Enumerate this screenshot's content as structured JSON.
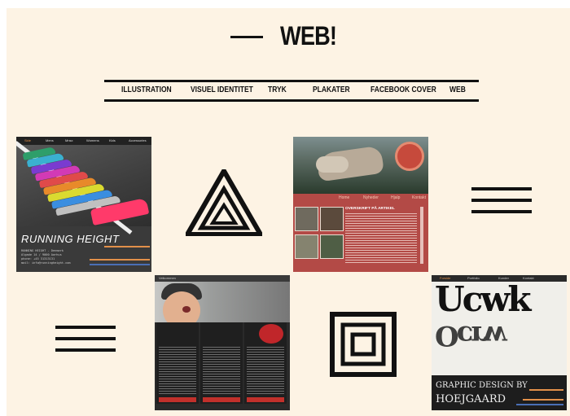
{
  "header": {
    "title": "WEB!"
  },
  "nav": [
    "ILLUSTRATION",
    "VISUEL IDENTITET",
    "TRYK",
    "PLAKATER",
    "FACEBOOK COVER",
    "WEB"
  ],
  "thumb1": {
    "menu": [
      "Side",
      "Mens",
      "Mnsx",
      "Womens",
      "Kids",
      "Accessories"
    ],
    "brand": "RUNNING HEIGHT",
    "meta": [
      "RUNNING HEIGHT - Denmark",
      "Algade 14 / 9000 Aarhus",
      "phone: +45 31313131",
      "mail: info@runningheight.com"
    ],
    "shoe_colors": [
      "#2e9e6a",
      "#3ab0d0",
      "#7a3bd0",
      "#d23ab5",
      "#e04a4a",
      "#e88a2a",
      "#dada30",
      "#3a8ee0",
      "#c0c0c0",
      "#ff3a6a"
    ]
  },
  "thumb2": {
    "tabs": [
      "Home",
      "Nyheder",
      "Hjalp",
      "Kontakt"
    ],
    "heading": "OVERSKRIFT PÅ ARTIKEL"
  },
  "thumb3": {
    "topbar": "Velkommen"
  },
  "thumb4": {
    "menu": [
      "Forside",
      "Portfolio",
      "Kunder",
      "Kontakt"
    ],
    "letters": "Ucwk",
    "letters_mirror": "Ocrw",
    "line1": "GRAPHIC DESIGN BY",
    "line2": "HOEJGAARD"
  },
  "colors": {
    "background": "#fdf3e4",
    "ink": "#111111",
    "accent_orange": "#e2904a",
    "accent_blue": "#4a6fb5"
  }
}
